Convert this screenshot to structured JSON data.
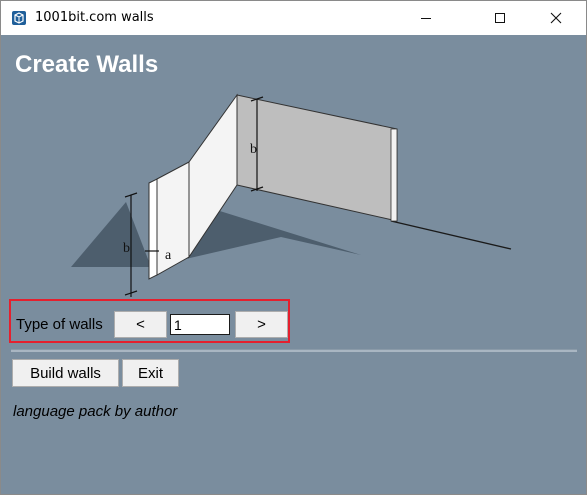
{
  "window": {
    "title": "1001bit.com walls"
  },
  "main": {
    "heading": "Create Walls",
    "illustration": {
      "label_b_left": "b",
      "label_a": "a",
      "label_b_right": "b"
    },
    "type_label": "Type of walls",
    "prev_label": "<",
    "next_label": ">",
    "type_value": "1",
    "build_label": "Build walls",
    "exit_label": "Exit",
    "credit": "language pack by author"
  },
  "colors": {
    "background": "#7a8d9e",
    "highlight_border": "#e5202e"
  },
  "icons": {
    "app": "sketchup-cube-icon",
    "minimize": "minimize-icon",
    "maximize": "maximize-icon",
    "close": "close-icon"
  }
}
